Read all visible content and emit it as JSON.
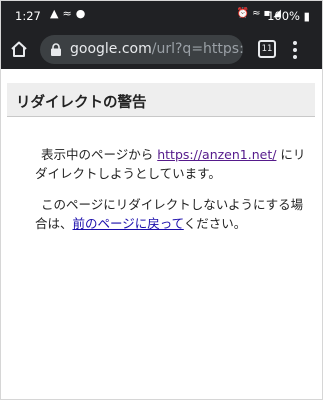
{
  "status_bar": {
    "time": "1:27",
    "battery": "100%",
    "left_icons": [
      "notification-icon",
      "sync-icon",
      "messenger-icon"
    ],
    "right_icons": [
      "alarm-icon",
      "wifi-icon",
      "volte-icon",
      "signal-icon"
    ]
  },
  "browser": {
    "url_host": "google.com",
    "url_path": "/url?q=https://a",
    "tab_count": "11"
  },
  "page": {
    "heading": "リダイレクトの警告",
    "message": {
      "before": "表示中のページから ",
      "link": "https://anzen1.net/",
      "after": " にリダイレクトしようとしています。"
    },
    "back": {
      "before": "このページにリダイレクトしないようにする場合は、",
      "link": "前のページに戻って",
      "after": "ください。"
    }
  }
}
